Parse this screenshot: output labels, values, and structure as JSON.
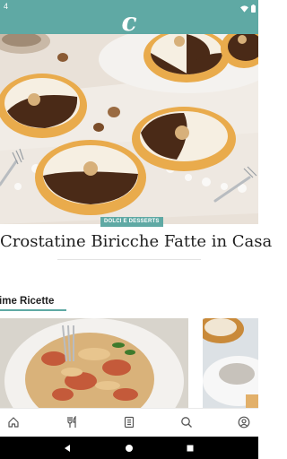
{
  "status_bar": {
    "time": "4",
    "icons": [
      "wifi-icon",
      "battery-icon"
    ]
  },
  "app": {
    "logo": "c",
    "brand_color": "#5fa9a4"
  },
  "hero": {
    "category": "DOLCI E DESSERTS",
    "title": "Crostatine Biricche Fatte in Casa"
  },
  "recent": {
    "title": "ltime Ricette",
    "cards": [
      {
        "image": "pasta-dish-image"
      },
      {
        "image": "dessert-image"
      }
    ]
  },
  "tab_bar": {
    "items": [
      {
        "icon": "home-icon"
      },
      {
        "icon": "cutlery-icon"
      },
      {
        "icon": "book-icon"
      },
      {
        "icon": "search-icon"
      },
      {
        "icon": "user-icon"
      }
    ]
  },
  "nav_bar": {
    "items": [
      "back-icon",
      "home-circle-icon",
      "recents-icon"
    ]
  }
}
